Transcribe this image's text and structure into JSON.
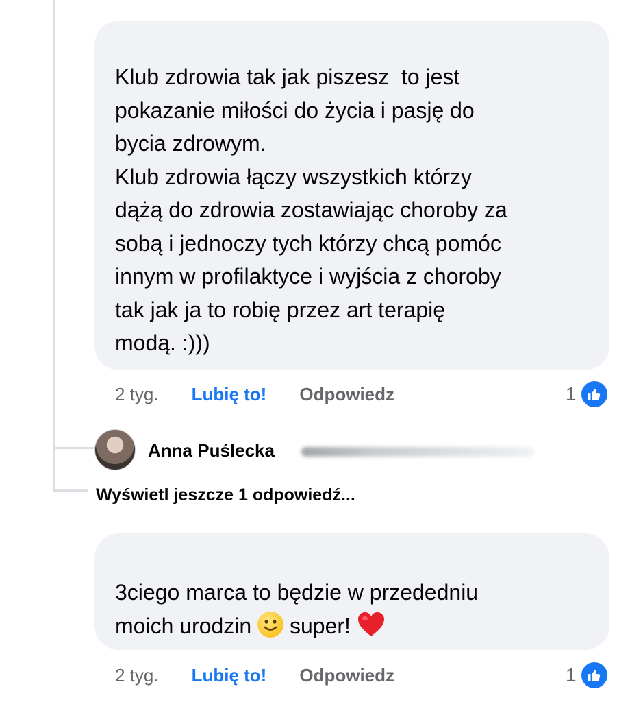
{
  "comment1": {
    "text": "Klub zdrowia tak jak piszesz  to jest\npokazanie miłości do życia i pasję do\nbycia zdrowym.\nKlub zdrowia łączy wszystkich którzy\ndążą do zdrowia zostawiając choroby za\nsobą i jednoczy tych którzy chcą pomóc\ninnym w profilaktyce i wyjścia z choroby\ntak jak ja to robię przez art terapię\nmodą. :)))",
    "time": "2 tyg.",
    "like_label": "Lubię to!",
    "reply_label": "Odpowiedz",
    "reaction_count": "1"
  },
  "reply_preview": {
    "author": "Anna Puślecka",
    "view_more_label": "Wyświetl jeszcze 1 odpowiedź..."
  },
  "comment2": {
    "text_part1": "3ciego marca to będzie w przededniu\nmoich urodzin ",
    "text_part2": " super! ",
    "time": "2 tyg.",
    "like_label": "Lubię to!",
    "reply_label": "Odpowiedz",
    "reaction_count": "1"
  },
  "icons": {
    "like_badge": "thumbs-up-icon",
    "smile_emoji": "slightly-smiling-face-emoji",
    "heart_emoji": "red-heart-emoji"
  },
  "colors": {
    "bubble_bg": "#f0f2f5",
    "accent": "#1877f2",
    "secondary_text": "#65676b"
  }
}
